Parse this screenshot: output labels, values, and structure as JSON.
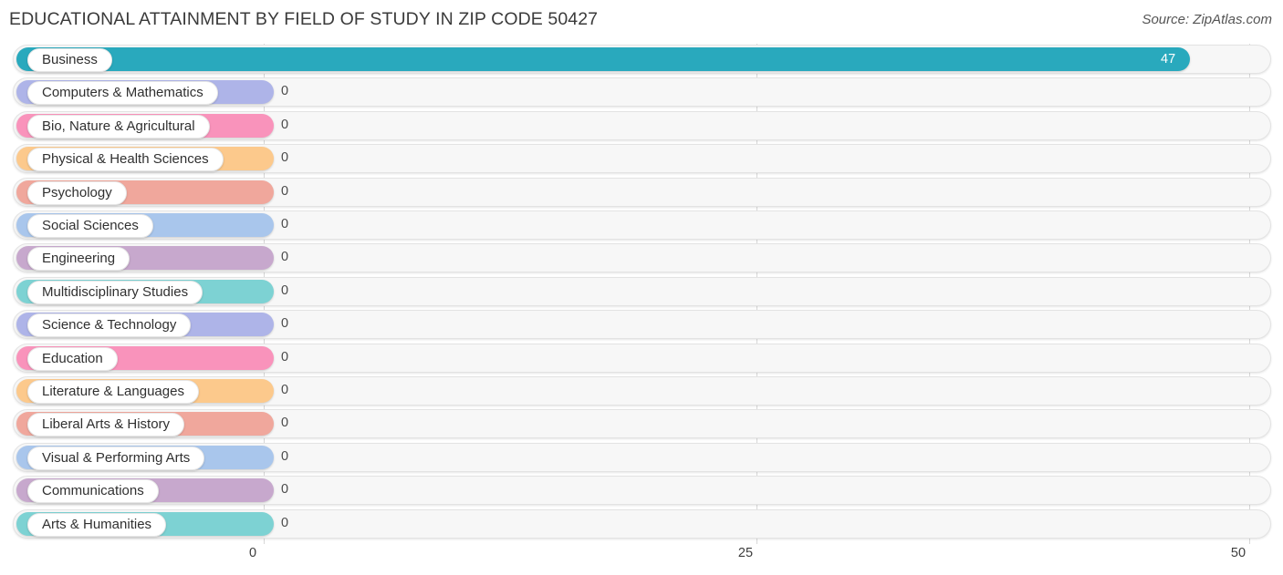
{
  "header": {
    "title": "EDUCATIONAL ATTAINMENT BY FIELD OF STUDY IN ZIP CODE 50427",
    "source": "Source: ZipAtlas.com"
  },
  "chart_data": {
    "type": "bar",
    "orientation": "horizontal",
    "title": "EDUCATIONAL ATTAINMENT BY FIELD OF STUDY IN ZIP CODE 50427",
    "xlabel": "",
    "ylabel": "",
    "xlim": [
      0,
      50
    ],
    "ticks": [
      "0",
      "25",
      "50"
    ],
    "tick_values": [
      0,
      25,
      50
    ],
    "grid": true,
    "legend": "none",
    "categories": [
      "Business",
      "Computers & Mathematics",
      "Bio, Nature & Agricultural",
      "Physical & Health Sciences",
      "Psychology",
      "Social Sciences",
      "Engineering",
      "Multidisciplinary Studies",
      "Science & Technology",
      "Education",
      "Literature & Languages",
      "Liberal Arts & History",
      "Visual & Performing Arts",
      "Communications",
      "Arts & Humanities"
    ],
    "values": [
      47,
      0,
      0,
      0,
      0,
      0,
      0,
      0,
      0,
      0,
      0,
      0,
      0,
      0,
      0
    ],
    "value_labels": [
      "47",
      "0",
      "0",
      "0",
      "0",
      "0",
      "0",
      "0",
      "0",
      "0",
      "0",
      "0",
      "0",
      "0",
      "0"
    ],
    "colors": [
      "#29a9bd",
      "#aeb4e8",
      "#f993bb",
      "#fcc98c",
      "#f0a79c",
      "#a9c6ec",
      "#c7a8cd",
      "#7dd2d3",
      "#aeb4e8",
      "#f993bb",
      "#fcc98c",
      "#f0a79c",
      "#a9c6ec",
      "#c7a8cd",
      "#7dd2d3"
    ]
  },
  "rows": [
    {
      "label": "Business",
      "value": "47",
      "color": "#29a9bd",
      "inside": true
    },
    {
      "label": "Computers & Mathematics",
      "value": "0",
      "color": "#aeb4e8",
      "inside": false
    },
    {
      "label": "Bio, Nature & Agricultural",
      "value": "0",
      "color": "#f993bb",
      "inside": false
    },
    {
      "label": "Physical & Health Sciences",
      "value": "0",
      "color": "#fcc98c",
      "inside": false
    },
    {
      "label": "Psychology",
      "value": "0",
      "color": "#f0a79c",
      "inside": false
    },
    {
      "label": "Social Sciences",
      "value": "0",
      "color": "#a9c6ec",
      "inside": false
    },
    {
      "label": "Engineering",
      "value": "0",
      "color": "#c7a8cd",
      "inside": false
    },
    {
      "label": "Multidisciplinary Studies",
      "value": "0",
      "color": "#7dd2d3",
      "inside": false
    },
    {
      "label": "Science & Technology",
      "value": "0",
      "color": "#aeb4e8",
      "inside": false
    },
    {
      "label": "Education",
      "value": "0",
      "color": "#f993bb",
      "inside": false
    },
    {
      "label": "Literature & Languages",
      "value": "0",
      "color": "#fcc98c",
      "inside": false
    },
    {
      "label": "Liberal Arts & History",
      "value": "0",
      "color": "#f0a79c",
      "inside": false
    },
    {
      "label": "Visual & Performing Arts",
      "value": "0",
      "color": "#a9c6ec",
      "inside": false
    },
    {
      "label": "Communications",
      "value": "0",
      "color": "#c7a8cd",
      "inside": false
    },
    {
      "label": "Arts & Humanities",
      "value": "0",
      "color": "#7dd2d3",
      "inside": false
    }
  ],
  "axis": {
    "ticks": [
      "0",
      "25",
      "50"
    ]
  }
}
